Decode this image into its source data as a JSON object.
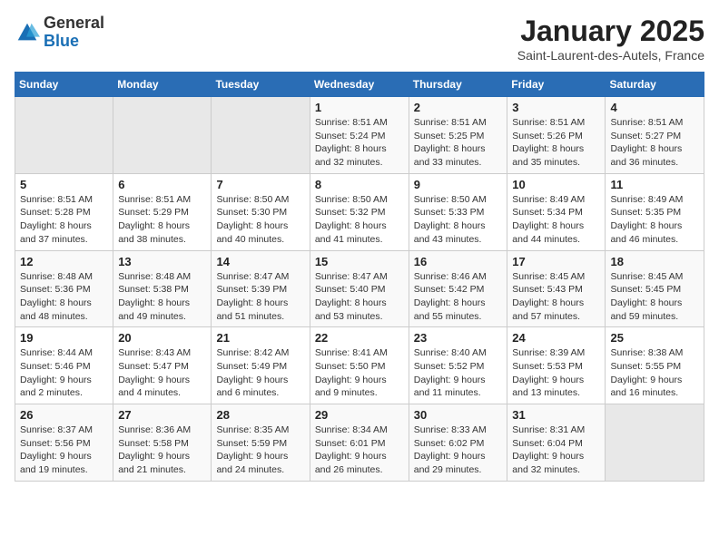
{
  "logo": {
    "general": "General",
    "blue": "Blue"
  },
  "header": {
    "title": "January 2025",
    "subtitle": "Saint-Laurent-des-Autels, France"
  },
  "weekdays": [
    "Sunday",
    "Monday",
    "Tuesday",
    "Wednesday",
    "Thursday",
    "Friday",
    "Saturday"
  ],
  "weeks": [
    [
      {
        "day": "",
        "info": ""
      },
      {
        "day": "",
        "info": ""
      },
      {
        "day": "",
        "info": ""
      },
      {
        "day": "1",
        "info": "Sunrise: 8:51 AM\nSunset: 5:24 PM\nDaylight: 8 hours and 32 minutes."
      },
      {
        "day": "2",
        "info": "Sunrise: 8:51 AM\nSunset: 5:25 PM\nDaylight: 8 hours and 33 minutes."
      },
      {
        "day": "3",
        "info": "Sunrise: 8:51 AM\nSunset: 5:26 PM\nDaylight: 8 hours and 35 minutes."
      },
      {
        "day": "4",
        "info": "Sunrise: 8:51 AM\nSunset: 5:27 PM\nDaylight: 8 hours and 36 minutes."
      }
    ],
    [
      {
        "day": "5",
        "info": "Sunrise: 8:51 AM\nSunset: 5:28 PM\nDaylight: 8 hours and 37 minutes."
      },
      {
        "day": "6",
        "info": "Sunrise: 8:51 AM\nSunset: 5:29 PM\nDaylight: 8 hours and 38 minutes."
      },
      {
        "day": "7",
        "info": "Sunrise: 8:50 AM\nSunset: 5:30 PM\nDaylight: 8 hours and 40 minutes."
      },
      {
        "day": "8",
        "info": "Sunrise: 8:50 AM\nSunset: 5:32 PM\nDaylight: 8 hours and 41 minutes."
      },
      {
        "day": "9",
        "info": "Sunrise: 8:50 AM\nSunset: 5:33 PM\nDaylight: 8 hours and 43 minutes."
      },
      {
        "day": "10",
        "info": "Sunrise: 8:49 AM\nSunset: 5:34 PM\nDaylight: 8 hours and 44 minutes."
      },
      {
        "day": "11",
        "info": "Sunrise: 8:49 AM\nSunset: 5:35 PM\nDaylight: 8 hours and 46 minutes."
      }
    ],
    [
      {
        "day": "12",
        "info": "Sunrise: 8:48 AM\nSunset: 5:36 PM\nDaylight: 8 hours and 48 minutes."
      },
      {
        "day": "13",
        "info": "Sunrise: 8:48 AM\nSunset: 5:38 PM\nDaylight: 8 hours and 49 minutes."
      },
      {
        "day": "14",
        "info": "Sunrise: 8:47 AM\nSunset: 5:39 PM\nDaylight: 8 hours and 51 minutes."
      },
      {
        "day": "15",
        "info": "Sunrise: 8:47 AM\nSunset: 5:40 PM\nDaylight: 8 hours and 53 minutes."
      },
      {
        "day": "16",
        "info": "Sunrise: 8:46 AM\nSunset: 5:42 PM\nDaylight: 8 hours and 55 minutes."
      },
      {
        "day": "17",
        "info": "Sunrise: 8:45 AM\nSunset: 5:43 PM\nDaylight: 8 hours and 57 minutes."
      },
      {
        "day": "18",
        "info": "Sunrise: 8:45 AM\nSunset: 5:45 PM\nDaylight: 8 hours and 59 minutes."
      }
    ],
    [
      {
        "day": "19",
        "info": "Sunrise: 8:44 AM\nSunset: 5:46 PM\nDaylight: 9 hours and 2 minutes."
      },
      {
        "day": "20",
        "info": "Sunrise: 8:43 AM\nSunset: 5:47 PM\nDaylight: 9 hours and 4 minutes."
      },
      {
        "day": "21",
        "info": "Sunrise: 8:42 AM\nSunset: 5:49 PM\nDaylight: 9 hours and 6 minutes."
      },
      {
        "day": "22",
        "info": "Sunrise: 8:41 AM\nSunset: 5:50 PM\nDaylight: 9 hours and 9 minutes."
      },
      {
        "day": "23",
        "info": "Sunrise: 8:40 AM\nSunset: 5:52 PM\nDaylight: 9 hours and 11 minutes."
      },
      {
        "day": "24",
        "info": "Sunrise: 8:39 AM\nSunset: 5:53 PM\nDaylight: 9 hours and 13 minutes."
      },
      {
        "day": "25",
        "info": "Sunrise: 8:38 AM\nSunset: 5:55 PM\nDaylight: 9 hours and 16 minutes."
      }
    ],
    [
      {
        "day": "26",
        "info": "Sunrise: 8:37 AM\nSunset: 5:56 PM\nDaylight: 9 hours and 19 minutes."
      },
      {
        "day": "27",
        "info": "Sunrise: 8:36 AM\nSunset: 5:58 PM\nDaylight: 9 hours and 21 minutes."
      },
      {
        "day": "28",
        "info": "Sunrise: 8:35 AM\nSunset: 5:59 PM\nDaylight: 9 hours and 24 minutes."
      },
      {
        "day": "29",
        "info": "Sunrise: 8:34 AM\nSunset: 6:01 PM\nDaylight: 9 hours and 26 minutes."
      },
      {
        "day": "30",
        "info": "Sunrise: 8:33 AM\nSunset: 6:02 PM\nDaylight: 9 hours and 29 minutes."
      },
      {
        "day": "31",
        "info": "Sunrise: 8:31 AM\nSunset: 6:04 PM\nDaylight: 9 hours and 32 minutes."
      },
      {
        "day": "",
        "info": ""
      }
    ]
  ]
}
